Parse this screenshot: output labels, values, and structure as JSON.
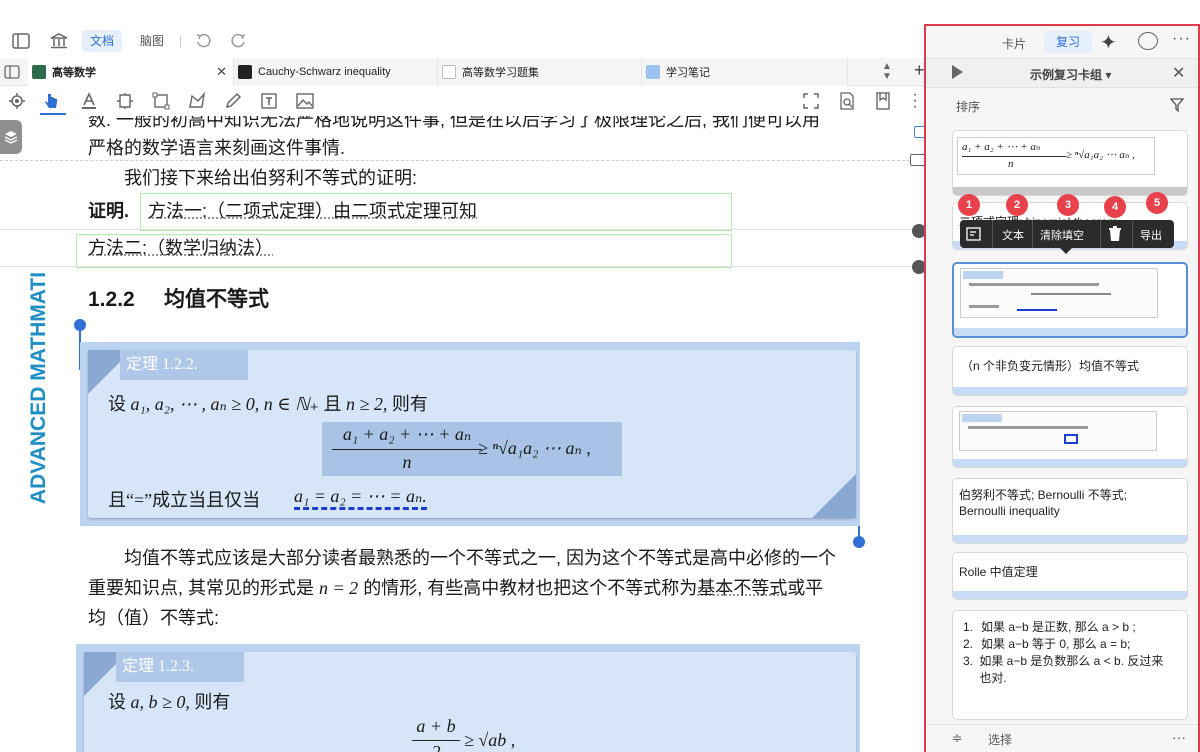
{
  "toolbar": {
    "doc_tab": "文档",
    "mindmap_tab": "脑图"
  },
  "tabs": [
    {
      "label": "高等数学"
    },
    {
      "label": "Cauchy-Schwarz inequality"
    },
    {
      "label": "高等数学习题集"
    },
    {
      "label": "学习笔记"
    }
  ],
  "sidebar_vertical_text": "ADVANCED MATHMATI",
  "doc": {
    "line1": "数. 一般的初高中知识无法严格地说明这件事, 但是在以后学习了极限理论之后, 我们便可以用",
    "line2": "严格的数学语言来刻画这件事情.",
    "line3": "我们接下来给出伯努利不等式的证明:",
    "proof_label": "证明.",
    "method1": "方法一:（二项式定理）由二项式定理可知",
    "method2": "方法二:（数学归纳法）",
    "section_num": "1.2.2",
    "section_title": "均值不等式",
    "theorem1": {
      "label": "定理 1.2.2.",
      "line1_pre": "设",
      "line1_math": "a₁, a₂, ⋯ , aₙ ≥ 0, n ∈ ℕ₊",
      "line1_mid": "且",
      "line1_math2": "n ≥ 2,",
      "line1_post": "则有",
      "frac_num": "a₁ + a₂ + ⋯ + aₙ",
      "frac_den": "n",
      "rhs": "≥ ⁿ√a₁a₂ ⋯ aₙ ,",
      "line3_pre": "且“=”成立当且仅当",
      "line3_math": "a₁ = a₂ = ⋯ = aₙ."
    },
    "para2_l1": "均值不等式应该是大部分读者最熟悉的一个不等式之一, 因为这个不等式是高中必修的一个",
    "para2_l2_a": "重要知识点, 其常见的形式是",
    "para2_l2_math": "n = 2",
    "para2_l2_b": "的情形, 有些高中教材也把这个不等式称为",
    "para2_l2_link": "基本不等式",
    "para2_l2_c": "或平",
    "para2_l3": "均（值）不等式:",
    "theorem2": {
      "label": "定理 1.2.3.",
      "line1_pre": "设",
      "line1_math": "a, b ≥ 0,",
      "line1_post": "则有",
      "frac_num": "a + b",
      "frac_den": "2",
      "rhs": "≥ √ab ,"
    }
  },
  "panel": {
    "tab_card": "卡片",
    "tab_review": "复习",
    "deck_title": "示例复习卡组 ▾",
    "sort_label": "排序",
    "select_label": "选择",
    "card1_num": "a₁ + a₂ + ⋯ + aₙ",
    "card1_den": "n",
    "card1_rhs": "≥ ⁿ√a₁a₂ ⋯ aₙ ,",
    "card2_text": "二项式定理; binomial theorem",
    "card4_text": "（n 个非负变元情形）均值不等式",
    "card6_text": "伯努利不等式; Bernoulli 不等式; Bernoulli inequality",
    "card7_text": "Rolle 中值定理",
    "card8_items": [
      "如果 a−b 是正数, 那么 a > b ;",
      "如果 a−b 等于 0, 那么 a = b;",
      "如果 a−b 是负数那么 a < b. 反过来也对."
    ],
    "popup": [
      {
        "num": "1",
        "label": ""
      },
      {
        "num": "2",
        "label": "文本"
      },
      {
        "num": "3",
        "label": "清除填空"
      },
      {
        "num": "4",
        "label": ""
      },
      {
        "num": "5",
        "label": "导出"
      }
    ]
  },
  "colors": {
    "accent": "#2f6fd6",
    "highlight_border": "#e23a4d",
    "badge": "#e8414b",
    "theorem_bg": "#bcd4f2"
  }
}
